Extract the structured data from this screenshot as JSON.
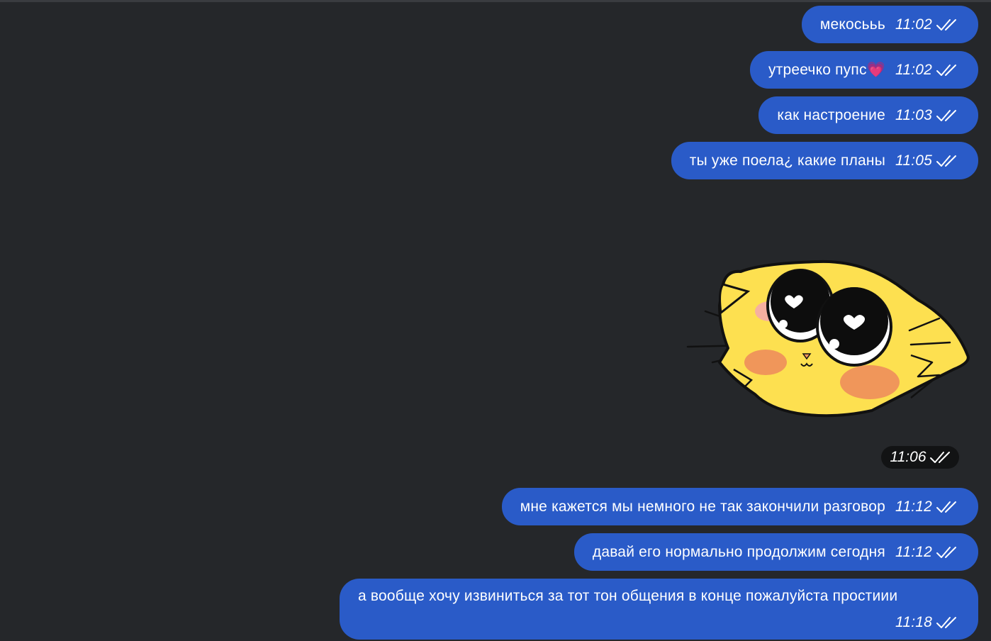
{
  "messages": [
    {
      "text": "мекосььь",
      "time": "11:02"
    },
    {
      "text": "утреечко пупс💗",
      "time": "11:02"
    },
    {
      "text": "как настроение",
      "time": "11:03"
    },
    {
      "text": "ты уже поела¿ какие планы",
      "time": "11:05"
    },
    {
      "text": "мне кажется мы немного не так закончили разговор",
      "time": "11:12"
    },
    {
      "text": "давай его нормально продолжим сегодня",
      "time": "11:12"
    },
    {
      "text": "а вообще хочу извиниться за тот тон общения в конце пожалуйста простиии",
      "time": "11:18"
    }
  ],
  "sticker": {
    "icon": "yellow-cat-sticker",
    "time": "11:06"
  },
  "status_icon": "double-check-icon",
  "colors": {
    "background": "#25272a",
    "outgoing_bubble": "#2a5bc8",
    "sticker_time_pill": "#121314",
    "text": "#ffffff",
    "sticker_yellow": "#fde050",
    "sticker_blush": "#f0965a"
  }
}
